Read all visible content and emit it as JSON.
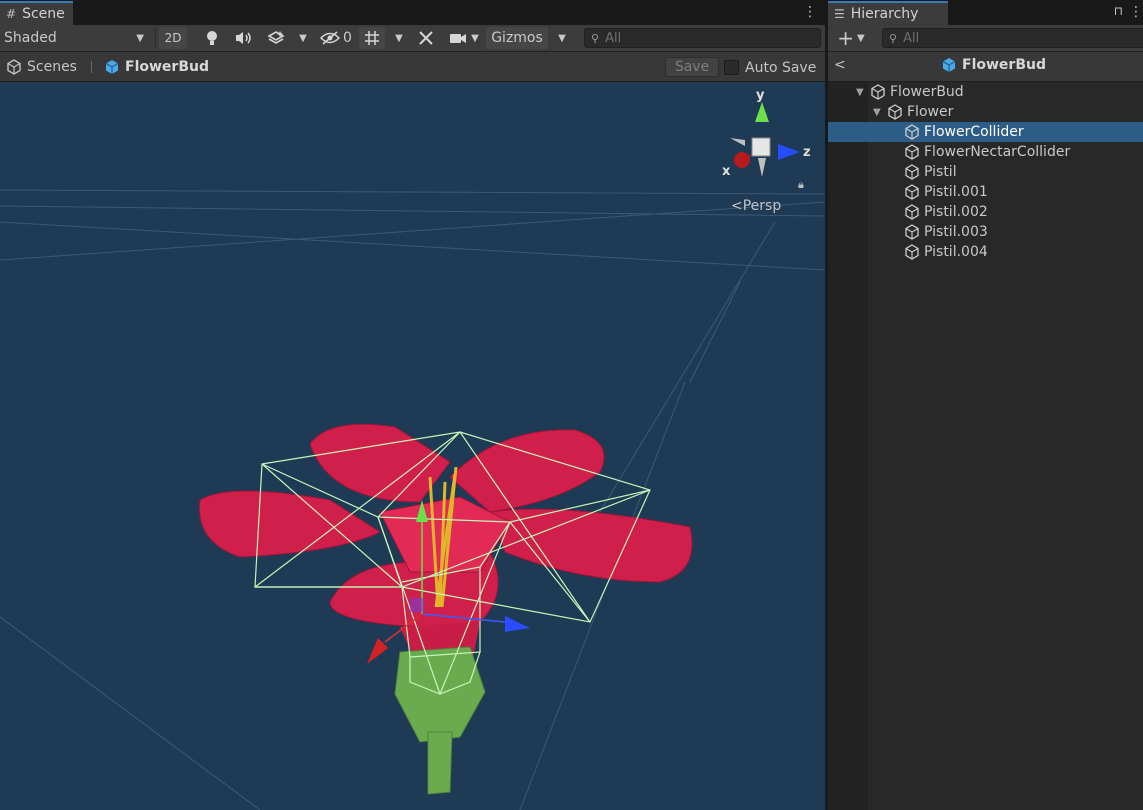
{
  "scene_tab": {
    "label": "Scene",
    "icon": "grid-icon"
  },
  "scene_toolbar": {
    "shading_mode": "Shaded",
    "btn_2d": "2D",
    "hidden_count": "0",
    "gizmos_label": "Gizmos",
    "search_placeholder": "All"
  },
  "breadcrumb": {
    "root_label": "Scenes",
    "prefab_label": "FlowerBud",
    "save_label": "Save",
    "autosave_label": "Auto Save",
    "autosave_checked": false
  },
  "viewport": {
    "projection_label": "Persp",
    "axis_labels": {
      "x": "x",
      "y": "y",
      "z": "z"
    },
    "colors": {
      "background": "#1e3a55",
      "petal": "#d01f4a",
      "stem": "#6bab4f",
      "collider": "#c8f5b8"
    }
  },
  "hierarchy": {
    "tab_label": "Hierarchy",
    "search_placeholder": "All",
    "header_title": "FlowerBud",
    "items": [
      {
        "label": "FlowerBud",
        "depth": 0,
        "expanded": true,
        "selected": false
      },
      {
        "label": "Flower",
        "depth": 1,
        "expanded": true,
        "selected": false
      },
      {
        "label": "FlowerCollider",
        "depth": 2,
        "selected": true
      },
      {
        "label": "FlowerNectarCollider",
        "depth": 2,
        "selected": false
      },
      {
        "label": "Pistil",
        "depth": 2,
        "selected": false
      },
      {
        "label": "Pistil.001",
        "depth": 2,
        "selected": false
      },
      {
        "label": "Pistil.002",
        "depth": 2,
        "selected": false
      },
      {
        "label": "Pistil.003",
        "depth": 2,
        "selected": false
      },
      {
        "label": "Pistil.004",
        "depth": 2,
        "selected": false
      }
    ]
  }
}
